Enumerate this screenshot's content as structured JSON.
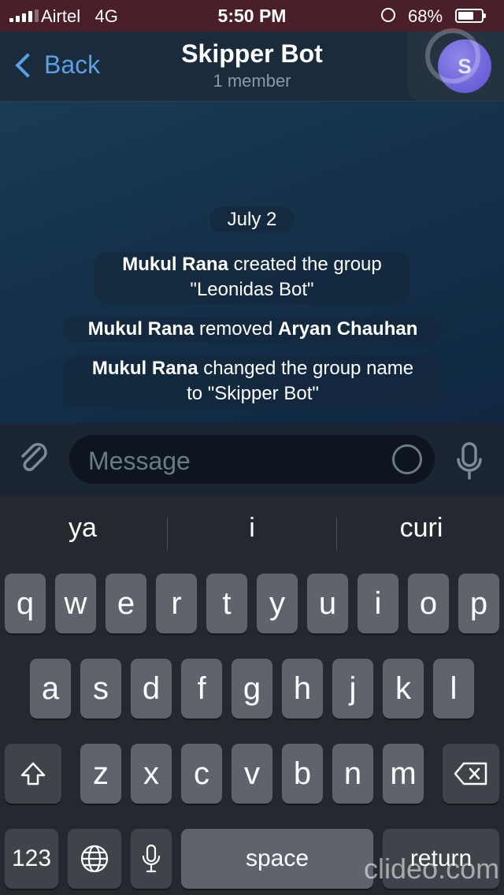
{
  "status_bar": {
    "carrier": "Airtel",
    "network": "4G",
    "time": "5:50 PM",
    "battery": "68%",
    "battery_level": 0.68
  },
  "header": {
    "back_label": "Back",
    "title": "Skipper Bot",
    "subtitle": "1 member",
    "avatar_initial": "S"
  },
  "chat": {
    "date": "July 2",
    "events": [
      {
        "actor": "Mukul Rana",
        "text": "created the group",
        "line2": "\"Leonidas Bot\""
      },
      {
        "actor": "Mukul Rana",
        "text": "removed",
        "target": "Aryan Chauhan"
      },
      {
        "actor": "Mukul Rana",
        "text": "changed the group name",
        "line2": "to \"Skipper Bot\""
      }
    ]
  },
  "composer": {
    "placeholder": "Message"
  },
  "keyboard": {
    "suggestions": [
      "ya",
      "i",
      "curi"
    ],
    "row1": [
      "q",
      "w",
      "e",
      "r",
      "t",
      "y",
      "u",
      "i",
      "o",
      "p"
    ],
    "row2": [
      "a",
      "s",
      "d",
      "f",
      "g",
      "h",
      "j",
      "k",
      "l"
    ],
    "row3": [
      "z",
      "x",
      "c",
      "v",
      "b",
      "n",
      "m"
    ],
    "numbers_label": "123",
    "space_label": "space",
    "return_label": "return"
  },
  "watermark": "clideo.com"
}
